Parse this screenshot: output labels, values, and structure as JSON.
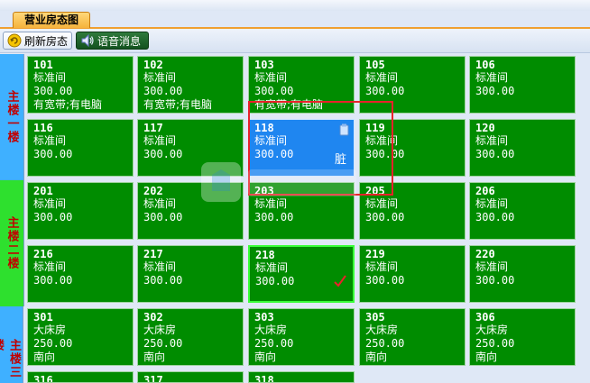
{
  "window": {
    "title_fragment": ""
  },
  "tabs": [
    {
      "label": "营业房态图",
      "active": true
    }
  ],
  "toolbar": {
    "refresh_label": "刷新房态",
    "voice_label": "语音消息"
  },
  "floors": [
    {
      "label": "主楼一楼"
    },
    {
      "label": "主楼二楼"
    },
    {
      "label": "主楼三楼"
    }
  ],
  "rooms": [
    {
      "number": "101",
      "type": "标准间",
      "price": "300.00",
      "note": "有宽带;有电脑"
    },
    {
      "number": "102",
      "type": "标准间",
      "price": "300.00",
      "note": "有宽带;有电脑"
    },
    {
      "number": "103",
      "type": "标准间",
      "price": "300.00",
      "note": "有宽带;有电脑"
    },
    {
      "number": "105",
      "type": "标准间",
      "price": "300.00",
      "note": ""
    },
    {
      "number": "106",
      "type": "标准间",
      "price": "300.00",
      "note": ""
    },
    {
      "number": "116",
      "type": "标准间",
      "price": "300.00",
      "note": ""
    },
    {
      "number": "117",
      "type": "标准间",
      "price": "300.00",
      "note": ""
    },
    {
      "number": "118",
      "type": "标准间",
      "price": "300.00",
      "note": "",
      "status": "脏"
    },
    {
      "number": "119",
      "type": "标准间",
      "price": "300.00",
      "note": ""
    },
    {
      "number": "120",
      "type": "标准间",
      "price": "300.00",
      "note": ""
    },
    {
      "number": "201",
      "type": "标准间",
      "price": "300.00",
      "note": ""
    },
    {
      "number": "202",
      "type": "标准间",
      "price": "300.00",
      "note": ""
    },
    {
      "number": "203",
      "type": "标准间",
      "price": "300.00",
      "note": ""
    },
    {
      "number": "205",
      "type": "标准间",
      "price": "300.00",
      "note": ""
    },
    {
      "number": "206",
      "type": "标准间",
      "price": "300.00",
      "note": ""
    },
    {
      "number": "216",
      "type": "标准间",
      "price": "300.00",
      "note": ""
    },
    {
      "number": "217",
      "type": "标准间",
      "price": "300.00",
      "note": ""
    },
    {
      "number": "218",
      "type": "标准间",
      "price": "300.00",
      "note": ""
    },
    {
      "number": "219",
      "type": "标准间",
      "price": "300.00",
      "note": ""
    },
    {
      "number": "220",
      "type": "标准间",
      "price": "300.00",
      "note": ""
    },
    {
      "number": "301",
      "type": "大床房",
      "price": "250.00",
      "note": "南向"
    },
    {
      "number": "302",
      "type": "大床房",
      "price": "250.00",
      "note": "南向"
    },
    {
      "number": "303",
      "type": "大床房",
      "price": "250.00",
      "note": "南向"
    },
    {
      "number": "305",
      "type": "大床房",
      "price": "250.00",
      "note": "南向"
    },
    {
      "number": "306",
      "type": "大床房",
      "price": "250.00",
      "note": "南向"
    },
    {
      "number": "316",
      "type": "",
      "price": "",
      "note": ""
    },
    {
      "number": "317",
      "type": "",
      "price": "",
      "note": ""
    },
    {
      "number": "318",
      "type": "",
      "price": "",
      "note": ""
    }
  ],
  "colors": {
    "room_green": "#008c00",
    "room_selected": "#1f86f0",
    "floor_label": "#c00000",
    "annotation_box": "#e8222a"
  },
  "icons": {
    "refresh": "refresh-icon",
    "voice": "speaker-icon",
    "check": "checkmark-icon",
    "badge": "room-badge-icon"
  }
}
